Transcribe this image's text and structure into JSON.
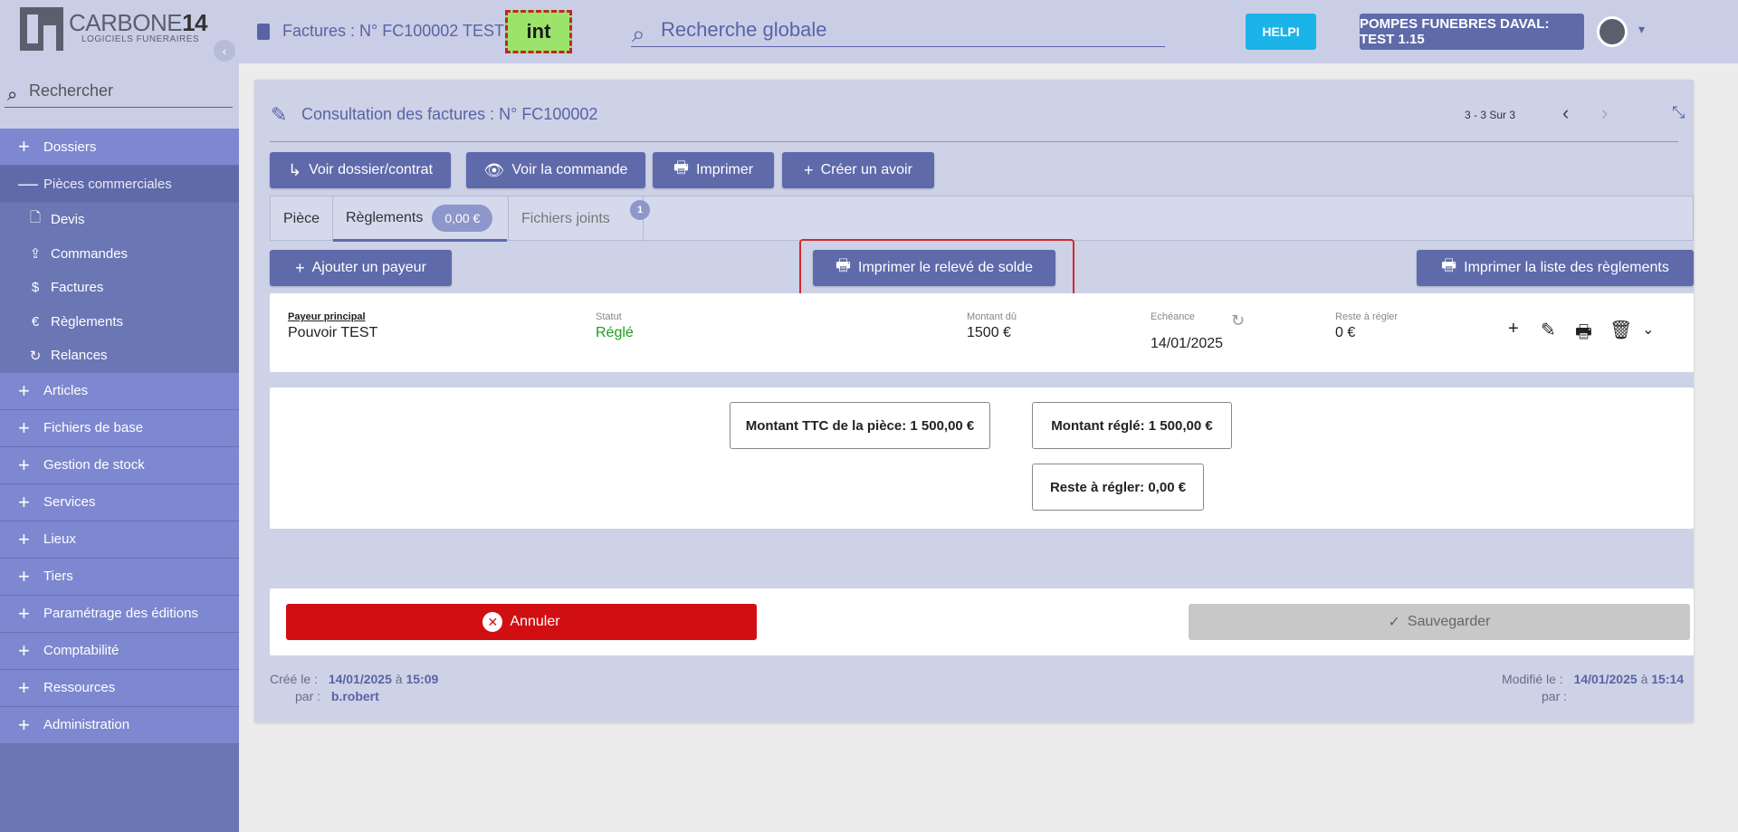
{
  "sidebar": {
    "logo_text_a": "CARBONE",
    "logo_text_b": "14",
    "logo_sub": "LOGICIELS FUNERAIRES",
    "collapse_icon": "chevron-left",
    "search_placeholder": "Rechercher",
    "items": [
      {
        "label": "Dossiers",
        "sign": "+"
      },
      {
        "label": "Pièces commerciales",
        "sign": "—"
      }
    ],
    "sub_items": [
      {
        "label": "Devis",
        "icon": "+"
      },
      {
        "label": "Commandes",
        "icon": "↥"
      },
      {
        "label": "Factures",
        "icon": "$"
      },
      {
        "label": "Règlements",
        "icon": "€"
      },
      {
        "label": "Relances",
        "icon": "↻"
      }
    ],
    "items_after": [
      {
        "label": "Articles"
      },
      {
        "label": "Fichiers de base"
      },
      {
        "label": "Gestion de stock"
      },
      {
        "label": "Services"
      },
      {
        "label": "Lieux"
      },
      {
        "label": "Tiers"
      },
      {
        "label": "Paramétrage des éditions"
      },
      {
        "label": "Comptabilité"
      },
      {
        "label": "Ressources"
      },
      {
        "label": "Administration"
      }
    ]
  },
  "topbar": {
    "title": "Factures : N° FC100002 TEST",
    "env": "int",
    "global_search": "Recherche globale",
    "help": "HELPI",
    "company": "POMPES FUNEBRES DAVAL: TEST 1.15"
  },
  "panel": {
    "title": "Consultation des factures : N° FC100002",
    "pager": "3 - 3 Sur 3",
    "actions": {
      "voir_dossier": "Voir dossier/contrat",
      "voir_commande": "Voir la commande",
      "imprimer": "Imprimer",
      "creer_avoir": "Créer un avoir"
    },
    "tabs": {
      "piece": "Pièce",
      "reglements": "Règlements",
      "reglements_amount": "0,00 €",
      "fichiers": "Fichiers joints",
      "fichiers_count": "1"
    },
    "toolbar": {
      "ajouter_payeur": "Ajouter un payeur",
      "imprimer_releve": "Imprimer le relevé de solde",
      "imprimer_liste": "Imprimer la liste des règlements"
    },
    "payer": {
      "payeur_label": "Payeur principal",
      "payeur": "Pouvoir TEST",
      "statut_label": "Statut",
      "statut": "Réglé",
      "montant_label": "Montant dû",
      "montant": "1500 €",
      "echeance_label": "Echéance",
      "echeance": "14/01/2025",
      "reste_label": "Reste à régler",
      "reste": "0 €"
    },
    "totals": {
      "ttc": "Montant TTC de la pièce:  1 500,00 €",
      "regle": "Montant réglé:   1 500,00 €",
      "reste": "Reste à régler:   0,00 €"
    },
    "footer": {
      "annuler": "Annuler",
      "sauvegarder": "Sauvegarder"
    },
    "meta": {
      "cree_label": "Créé le :",
      "cree_date": "14/01/2025",
      "a": "à",
      "cree_time": "15:09",
      "par_label": "par :",
      "cree_par": "b.robert",
      "modifie_label": "Modifié le :",
      "modifie_date": "14/01/2025",
      "modifie_time": "15:14"
    }
  },
  "colors": {
    "accent": "#5f6aaa",
    "danger": "#d10e12",
    "success": "#1e9b1e",
    "help": "#1ab4e8"
  }
}
